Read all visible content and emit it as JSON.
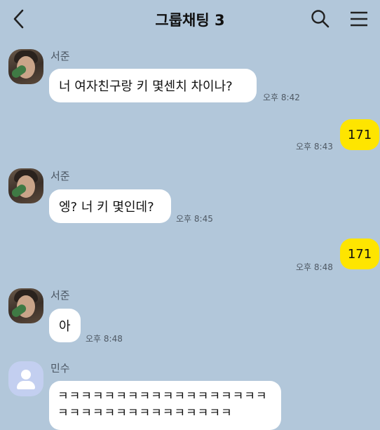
{
  "header": {
    "title": "그룹채팅 3",
    "back_icon": "back-chevron-icon",
    "search_icon": "search-icon",
    "menu_icon": "hamburger-menu-icon"
  },
  "colors": {
    "background": "#b2c7da",
    "my_bubble": "#fee500",
    "other_bubble": "#ffffff"
  },
  "messages": [
    {
      "sender": "서준",
      "text": "너 여자친구랑 키 몇센치 차이나?",
      "time": "오후 8:42"
    },
    {
      "text": "171",
      "time": "오후 8:43",
      "mine": true
    },
    {
      "sender": "서준",
      "text": "엥? 너 키 몇인데?",
      "time": "오후 8:45"
    },
    {
      "text": "171",
      "time": "오후 8:48",
      "mine": true
    },
    {
      "sender": "서준",
      "text": "아",
      "time": "오후 8:48"
    },
    {
      "sender": "민수",
      "text_line1": "ㅋㅋㅋㅋㅋㅋㅋㅋㅋㅋㅋㅋㅋㅋㅋㅋㅋㅋ",
      "text_line2": "ㅋㅋㅋㅋㅋㅋㅋㅋㅋㅋㅋㅋㅋㅋㅋ"
    }
  ]
}
